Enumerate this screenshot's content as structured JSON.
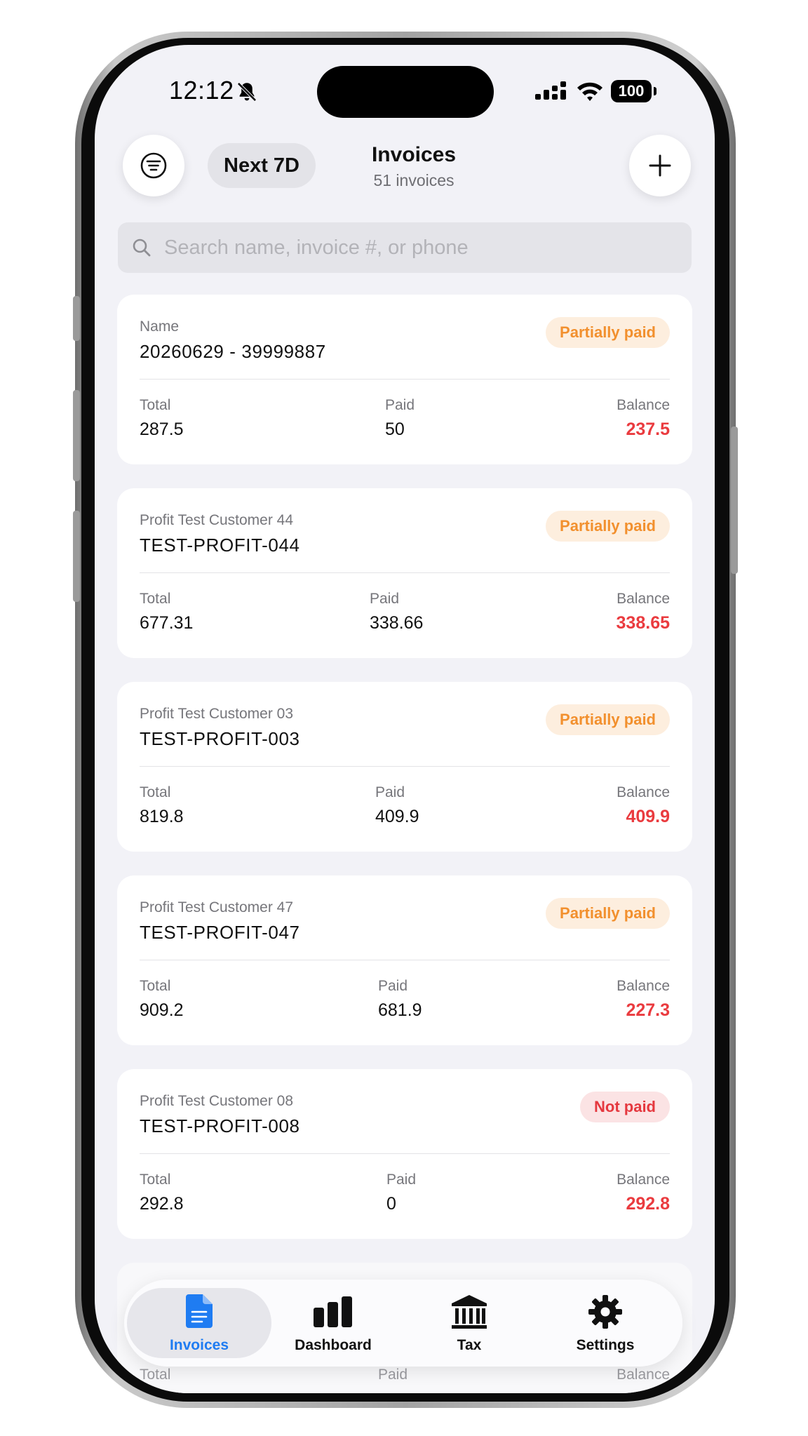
{
  "status_bar": {
    "time": "12:12",
    "battery": "100"
  },
  "header": {
    "filter_chip": "Next 7D",
    "title": "Invoices",
    "subtitle": "51 invoices"
  },
  "search": {
    "placeholder": "Search name, invoice #, or phone",
    "value": ""
  },
  "invoices": [
    {
      "customer": "Name",
      "number": "20260629 - 39999887",
      "status": "Partially paid",
      "total_label": "Total",
      "total": "287.5",
      "paid_label": "Paid",
      "paid": "50",
      "balance_label": "Balance",
      "balance": "237.5"
    },
    {
      "customer": "Profit Test Customer 44",
      "number": "TEST-PROFIT-044",
      "status": "Partially paid",
      "total_label": "Total",
      "total": "677.31",
      "paid_label": "Paid",
      "paid": "338.66",
      "balance_label": "Balance",
      "balance": "338.65"
    },
    {
      "customer": "Profit Test Customer 03",
      "number": "TEST-PROFIT-003",
      "status": "Partially paid",
      "total_label": "Total",
      "total": "819.8",
      "paid_label": "Paid",
      "paid": "409.9",
      "balance_label": "Balance",
      "balance": "409.9"
    },
    {
      "customer": "Profit Test Customer 47",
      "number": "TEST-PROFIT-047",
      "status": "Partially paid",
      "total_label": "Total",
      "total": "909.2",
      "paid_label": "Paid",
      "paid": "681.9",
      "balance_label": "Balance",
      "balance": "227.3"
    },
    {
      "customer": "Profit Test Customer 08",
      "number": "TEST-PROFIT-008",
      "status": "Not paid",
      "total_label": "Total",
      "total": "292.8",
      "paid_label": "Paid",
      "paid": "0",
      "balance_label": "Balance",
      "balance": "292.8"
    }
  ],
  "partial_card": {
    "total_label": "Total",
    "paid_label": "Paid",
    "balance_label": "Balance"
  },
  "tabbar": {
    "items": [
      {
        "label": "Invoices",
        "icon": "document-icon",
        "active": true
      },
      {
        "label": "Dashboard",
        "icon": "bar-chart-icon",
        "active": false
      },
      {
        "label": "Tax",
        "icon": "bank-icon",
        "active": false
      },
      {
        "label": "Settings",
        "icon": "gear-icon",
        "active": false
      }
    ]
  },
  "colors": {
    "accent": "#1f7cf2",
    "partial_badge_text": "#f2902e",
    "unpaid_badge_text": "#e5383f",
    "balance": "#ea3b3f",
    "background": "#f2f2f7"
  }
}
